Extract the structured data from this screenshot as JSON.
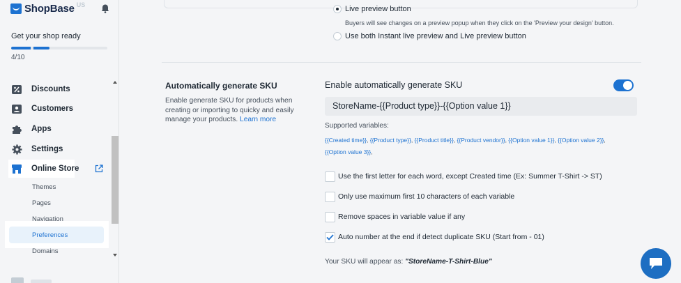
{
  "brand": {
    "name": "ShopBase",
    "region": "US",
    "brand_color": "#1d72d1"
  },
  "onboarding": {
    "title": "Get your shop ready",
    "progress_text": "4/10",
    "progress_value": 0.4
  },
  "sidebar": {
    "items": [
      {
        "label": "Discounts",
        "icon": "discount-icon"
      },
      {
        "label": "Customers",
        "icon": "customers-icon"
      },
      {
        "label": "Apps",
        "icon": "puzzle-icon"
      },
      {
        "label": "Settings",
        "icon": "gear-icon"
      },
      {
        "label": "Online Store",
        "icon": "store-icon"
      }
    ],
    "online_store_sub": [
      "Themes",
      "Pages",
      "Navigation",
      "Preferences",
      "Domains"
    ],
    "selected_sub": "Preferences"
  },
  "preview_options": {
    "live_preview_label": "Live preview button",
    "live_preview_help": "Buyers will see changes on a preview popup when they click on the 'Preview your design' button.",
    "both_label": "Use both Instant live preview and Live preview button"
  },
  "sku_section": {
    "title": "Automatically generate SKU",
    "description": "Enable generate SKU for products when creating or importing to quicky and easily manage your products.",
    "learn_more": "Learn more",
    "enable_label": "Enable automatically generate SKU",
    "enabled": true,
    "template_value": "StoreName-{{Product type}}-{{Option value 1}}",
    "supported_title": "Supported variables:",
    "variables": [
      "{{Created time}}",
      "{{Product type}}",
      "{{Product title}}",
      "{{Product vendor}}",
      "{{Option value 1}}",
      "{{Option value 2}}",
      "{{Option value 3}}"
    ],
    "options": [
      {
        "label": "Use the first letter for each word, except Created time (Ex: Summer T-Shirt -> ST)",
        "checked": false
      },
      {
        "label": "Only use maximum first 10 characters of each variable",
        "checked": false
      },
      {
        "label": "Remove spaces in variable value if any",
        "checked": false
      },
      {
        "label": "Auto number at the end if detect duplicate SKU (Start from - 01)",
        "checked": true
      }
    ],
    "result_prefix": "Your SKU will appear as:",
    "result_value": "\"StoreName-T-Shirt-Blue\""
  }
}
